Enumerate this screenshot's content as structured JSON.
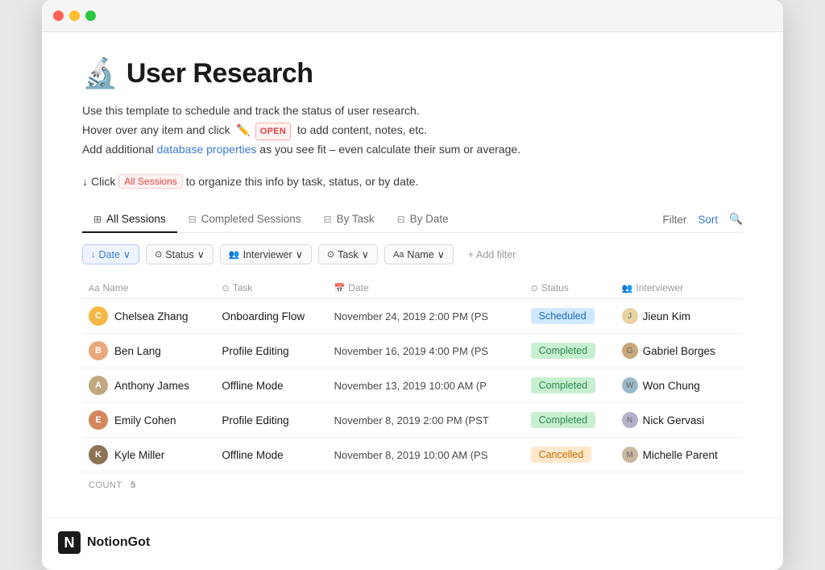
{
  "window": {
    "title": "User Research"
  },
  "page": {
    "emoji": "🔬",
    "title": "User Research",
    "description_line1": "Use this template to schedule and track the status of user research.",
    "description_line2_pre": "Hover over any item and click",
    "description_line2_open": "OPEN",
    "description_line2_post": "to add content, notes, etc.",
    "description_line3_pre": "Add additional",
    "description_line3_link": "database properties",
    "description_line3_post": "as you see fit – even calculate their sum or average.",
    "click_hint_arrow": "↓",
    "click_hint_pre": "Click",
    "click_hint_badge": "All Sessions",
    "click_hint_post": "to organize this info by task, status, or by date."
  },
  "tabs": [
    {
      "label": "All Sessions",
      "icon": "⊞",
      "active": true
    },
    {
      "label": "Completed Sessions",
      "icon": "⊟",
      "active": false
    },
    {
      "label": "By Task",
      "icon": "⊟",
      "active": false
    },
    {
      "label": "By Date",
      "icon": "⊟",
      "active": false
    }
  ],
  "tab_actions": {
    "filter": "Filter",
    "sort": "Sort",
    "search_icon": "🔍"
  },
  "filters": [
    {
      "icon": "↓",
      "label": "Date",
      "active": true
    },
    {
      "icon": "⊙",
      "label": "Status",
      "active": false
    },
    {
      "icon": "👥",
      "label": "Interviewer",
      "active": false
    },
    {
      "icon": "⊙",
      "label": "Task",
      "active": false
    },
    {
      "icon": "Aa",
      "label": "Name",
      "active": false
    }
  ],
  "add_filter_label": "+ Add filter",
  "table": {
    "columns": [
      {
        "icon": "Aa",
        "label": "Name"
      },
      {
        "icon": "⊙",
        "label": "Task"
      },
      {
        "icon": "📅",
        "label": "Date"
      },
      {
        "icon": "⊙",
        "label": "Status"
      },
      {
        "icon": "👥",
        "label": "Interviewer"
      }
    ],
    "rows": [
      {
        "name": "Chelsea Zhang",
        "avatar_color": "#f4b942",
        "avatar_initials": "C",
        "task": "Onboarding Flow",
        "date": "November 24, 2019 2:00 PM (PS",
        "status": "Scheduled",
        "status_class": "status-scheduled",
        "interviewer": "Jieun Kim",
        "interviewer_initials": "J",
        "interviewer_bg": "#e8d4a0"
      },
      {
        "name": "Ben Lang",
        "avatar_color": "#e8a87c",
        "avatar_initials": "B",
        "task": "Profile Editing",
        "date": "November 16, 2019 4:00 PM (PS",
        "status": "Completed",
        "status_class": "status-completed",
        "interviewer": "Gabriel Borges",
        "interviewer_initials": "G",
        "interviewer_bg": "#c8a87c"
      },
      {
        "name": "Anthony James",
        "avatar_color": "#c0a882",
        "avatar_initials": "A",
        "task": "Offline Mode",
        "date": "November 13, 2019 10:00 AM (P",
        "status": "Completed",
        "status_class": "status-completed",
        "interviewer": "Won Chung",
        "interviewer_initials": "W",
        "interviewer_bg": "#9ab8c8"
      },
      {
        "name": "Emily Cohen",
        "avatar_color": "#d4865c",
        "avatar_initials": "E",
        "task": "Profile Editing",
        "date": "November 8, 2019 2:00 PM (PST",
        "status": "Completed",
        "status_class": "status-completed",
        "interviewer": "Nick Gervasi",
        "interviewer_initials": "N",
        "interviewer_bg": "#b8b0c8"
      },
      {
        "name": "Kyle Miller",
        "avatar_color": "#8b7355",
        "avatar_initials": "K",
        "task": "Offline Mode",
        "date": "November 8, 2019 10:00 AM (PS",
        "status": "Cancelled",
        "status_class": "status-cancelled",
        "interviewer": "Michelle Parent",
        "interviewer_initials": "M",
        "interviewer_bg": "#c8b8a0"
      }
    ]
  },
  "count_label": "COUNT",
  "count_value": "5",
  "footer": {
    "brand": "NotionGot"
  }
}
